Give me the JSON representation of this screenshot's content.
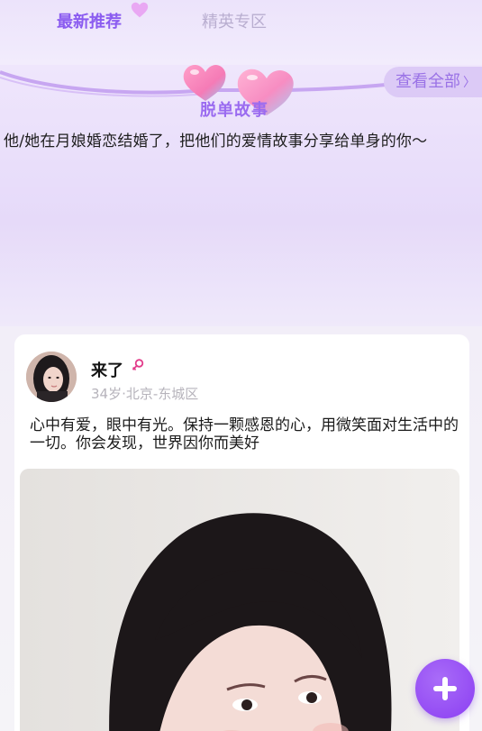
{
  "tabs": {
    "active": "最新推荐",
    "inactive": "精英专区"
  },
  "banner": {
    "title": "脱单故事",
    "view_all": "查看全部",
    "description": "他/她在月娘婚恋结婚了，把他们的爱情故事分享给单身的你～"
  },
  "post": {
    "username": "来了",
    "meta": "34岁·北京-东城区",
    "text": "心中有爱，眼中有光。保持一颗感恩的心，用微笑面对生活中的一切。你会发现，世界因你而美好"
  },
  "colors": {
    "accent": "#8b5cf0",
    "fab": "#9a4ff5",
    "gender": "#e23b8a"
  },
  "icons": {
    "tab_heart": "heart-icon",
    "view_all_chevron": "chevron-right-icon",
    "gender": "female-icon",
    "fab": "plus-icon"
  }
}
